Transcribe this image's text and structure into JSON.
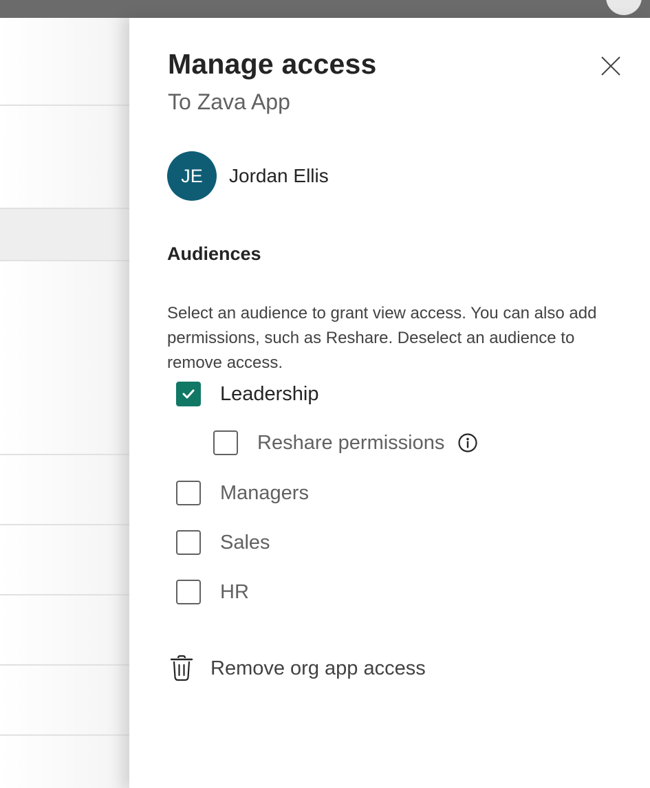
{
  "panel": {
    "title": "Manage access",
    "subtitle": "To Zava App",
    "close_icon": "close-icon"
  },
  "user": {
    "initials": "JE",
    "name": "Jordan Ellis",
    "avatar_color": "#0f5d75"
  },
  "audiences": {
    "heading": "Audiences",
    "description": "Select an audience to grant view access. You can also add permissions, such as Reshare. Deselect an audience to remove access.",
    "items": [
      {
        "label": "Leadership",
        "checked": true
      },
      {
        "label": "Reshare permissions",
        "checked": false,
        "sub": true,
        "info_icon": "info-icon"
      },
      {
        "label": "Managers",
        "checked": false
      },
      {
        "label": "Sales",
        "checked": false
      },
      {
        "label": "HR",
        "checked": false
      }
    ]
  },
  "remove_action": {
    "label": "Remove org app access",
    "icon": "trash-icon"
  },
  "colors": {
    "accent": "#117865",
    "topbar": "#6b6b6b"
  }
}
